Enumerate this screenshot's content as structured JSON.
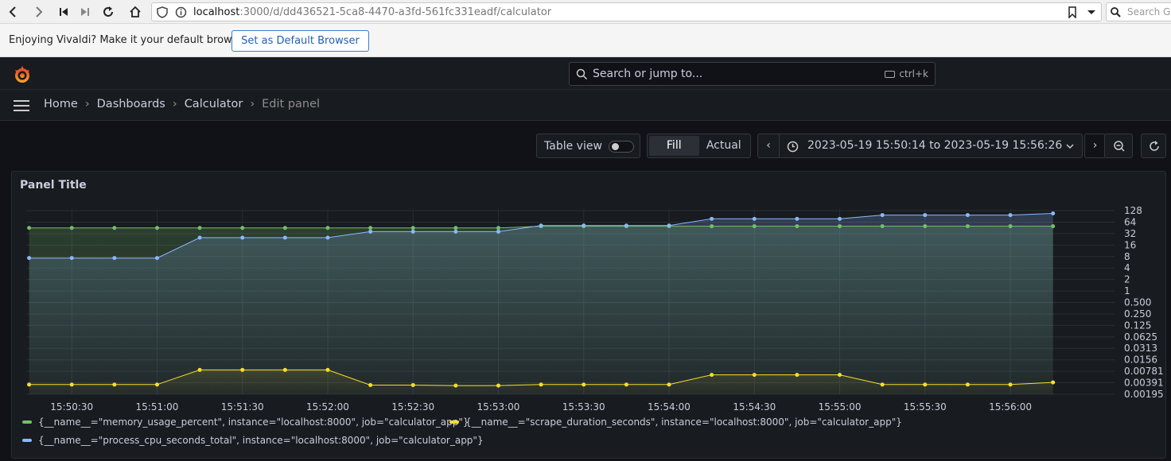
{
  "browser": {
    "url_host": "localhost",
    "url_rest": ":3000/d/dd436521-5ca8-4470-a3fd-561fc331eadf/calculator",
    "search_placeholder": "Search Go",
    "notice_text": "Enjoying Vivaldi? Make it your default browser.",
    "default_button": "Set as Default Browser"
  },
  "grafana": {
    "search_placeholder": "Search or jump to...",
    "search_shortcut": "ctrl+k",
    "breadcrumb": [
      "Home",
      "Dashboards",
      "Calculator",
      "Edit panel"
    ],
    "toolbar": {
      "table_view_label": "Table view",
      "fill_label": "Fill",
      "actual_label": "Actual",
      "time_range": "2023-05-19 15:50:14 to 2023-05-19 15:56:26"
    },
    "panel_title": "Panel Title"
  },
  "colors": {
    "green": "#73bf69",
    "blue": "#8ab8ff",
    "yellow": "#fade2a"
  },
  "chart_data": {
    "type": "line",
    "y_scale": "log2",
    "x_ticks": [
      "15:50:30",
      "15:51:00",
      "15:51:30",
      "15:52:00",
      "15:52:30",
      "15:53:00",
      "15:53:30",
      "15:54:00",
      "15:54:30",
      "15:55:00",
      "15:55:30",
      "15:56:00"
    ],
    "y_ticks": [
      "128",
      "64",
      "32",
      "16",
      "8",
      "4",
      "2",
      "1",
      "0.500",
      "0.250",
      "0.125",
      "0.0625",
      "0.0313",
      "0.0156",
      "0.00781",
      "0.00391",
      "0.00195"
    ],
    "x": [
      "15:50:15",
      "15:50:30",
      "15:50:45",
      "15:51:00",
      "15:51:15",
      "15:51:30",
      "15:51:45",
      "15:52:00",
      "15:52:15",
      "15:52:30",
      "15:52:45",
      "15:53:00",
      "15:53:15",
      "15:53:30",
      "15:53:45",
      "15:54:00",
      "15:54:15",
      "15:54:30",
      "15:54:45",
      "15:55:00",
      "15:55:15",
      "15:55:30",
      "15:55:45",
      "15:56:00",
      "15:56:15"
    ],
    "series": [
      {
        "name": "{__name__=\"memory_usage_percent\", instance=\"localhost:8000\", job=\"calculator_app\"}",
        "color": "#73bf69",
        "values": [
          45,
          45,
          45,
          45,
          45,
          45,
          45,
          45,
          45,
          45,
          45,
          45,
          50,
          50,
          50,
          50,
          50,
          50,
          50,
          50,
          50,
          50,
          50,
          50,
          50
        ]
      },
      {
        "name": "{__name__=\"process_cpu_seconds_total\", instance=\"localhost:8000\", job=\"calculator_app\"}",
        "color": "#8ab8ff",
        "values": [
          7.3,
          7.3,
          7.3,
          7.3,
          25,
          25,
          25,
          25,
          36,
          36,
          36,
          36,
          52,
          52,
          52,
          52,
          78,
          78,
          78,
          78,
          98,
          98,
          98,
          98,
          108
        ]
      },
      {
        "name": "{__name__=\"scrape_duration_seconds\", instance=\"localhost:8000\", job=\"calculator_app\"}",
        "color": "#fade2a",
        "values": [
          0.0035,
          0.0035,
          0.0035,
          0.0035,
          0.0085,
          0.0085,
          0.0085,
          0.0085,
          0.0034,
          0.0034,
          0.0033,
          0.0033,
          0.0035,
          0.0035,
          0.0035,
          0.0035,
          0.0063,
          0.0063,
          0.0063,
          0.0063,
          0.0035,
          0.0035,
          0.0035,
          0.0035,
          0.004
        ]
      }
    ]
  }
}
